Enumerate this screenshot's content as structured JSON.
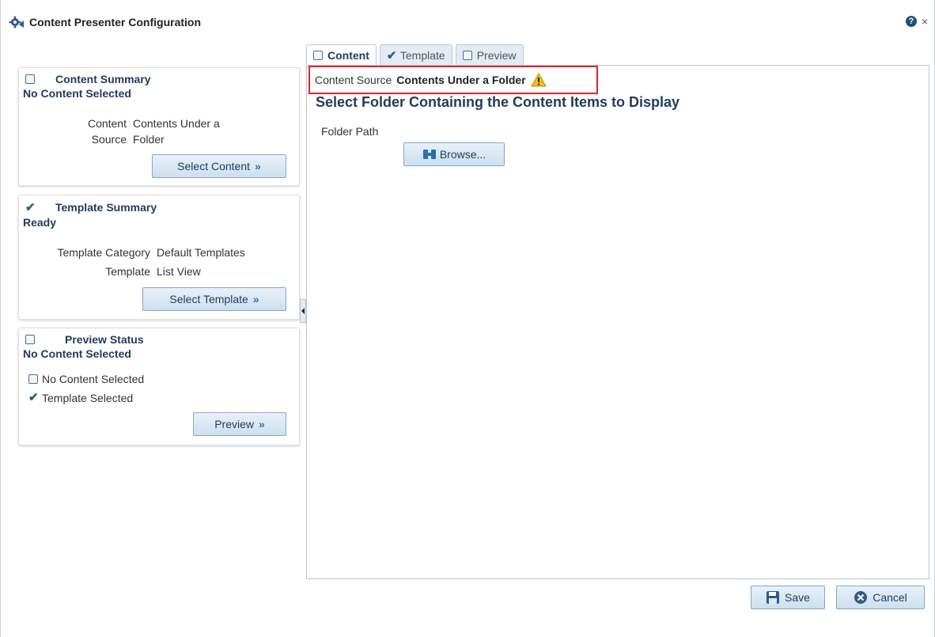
{
  "dialog": {
    "title": "Content Presenter Configuration",
    "help": "?",
    "close": "×"
  },
  "content_summary": {
    "header": "Content Summary",
    "status": "No Content Selected",
    "key1": "Content",
    "key2": "Source",
    "value1": "Contents Under a",
    "value2": "Folder",
    "button": "Select Content"
  },
  "template_summary": {
    "header": "Template Summary",
    "status": "Ready",
    "category_label": "Template Category",
    "category_value": "Default Templates",
    "template_label": "Template",
    "template_value": "List View",
    "button": "Select Template"
  },
  "preview_status": {
    "header": "Preview Status",
    "status": "No Content Selected",
    "item1": "No Content Selected",
    "item2": "Template Selected",
    "button": "Preview"
  },
  "tabs": [
    {
      "label": "Content",
      "active": true
    },
    {
      "label": "Template",
      "active": false
    },
    {
      "label": "Preview",
      "active": false
    }
  ],
  "main": {
    "source_label": "Content Source",
    "source_value": "Contents Under a Folder",
    "section_title": "Select Folder Containing the Content Items to Display",
    "folder_label": "Folder Path",
    "browse_button": "Browse..."
  },
  "footer": {
    "save": "Save",
    "cancel": "Cancel"
  },
  "colors": {
    "accent": "#1f3c5c",
    "button_top": "#e8f1fa",
    "button_bottom": "#cddfef",
    "highlight_border": "#e0252b",
    "warning": "#f2c200"
  },
  "icons": {
    "title": "gear-icon",
    "help": "help-icon",
    "close": "close-icon",
    "warning": "warning-icon",
    "browse": "browse-binoculars-icon",
    "save": "save-disk-icon",
    "cancel": "cancel-icon"
  }
}
